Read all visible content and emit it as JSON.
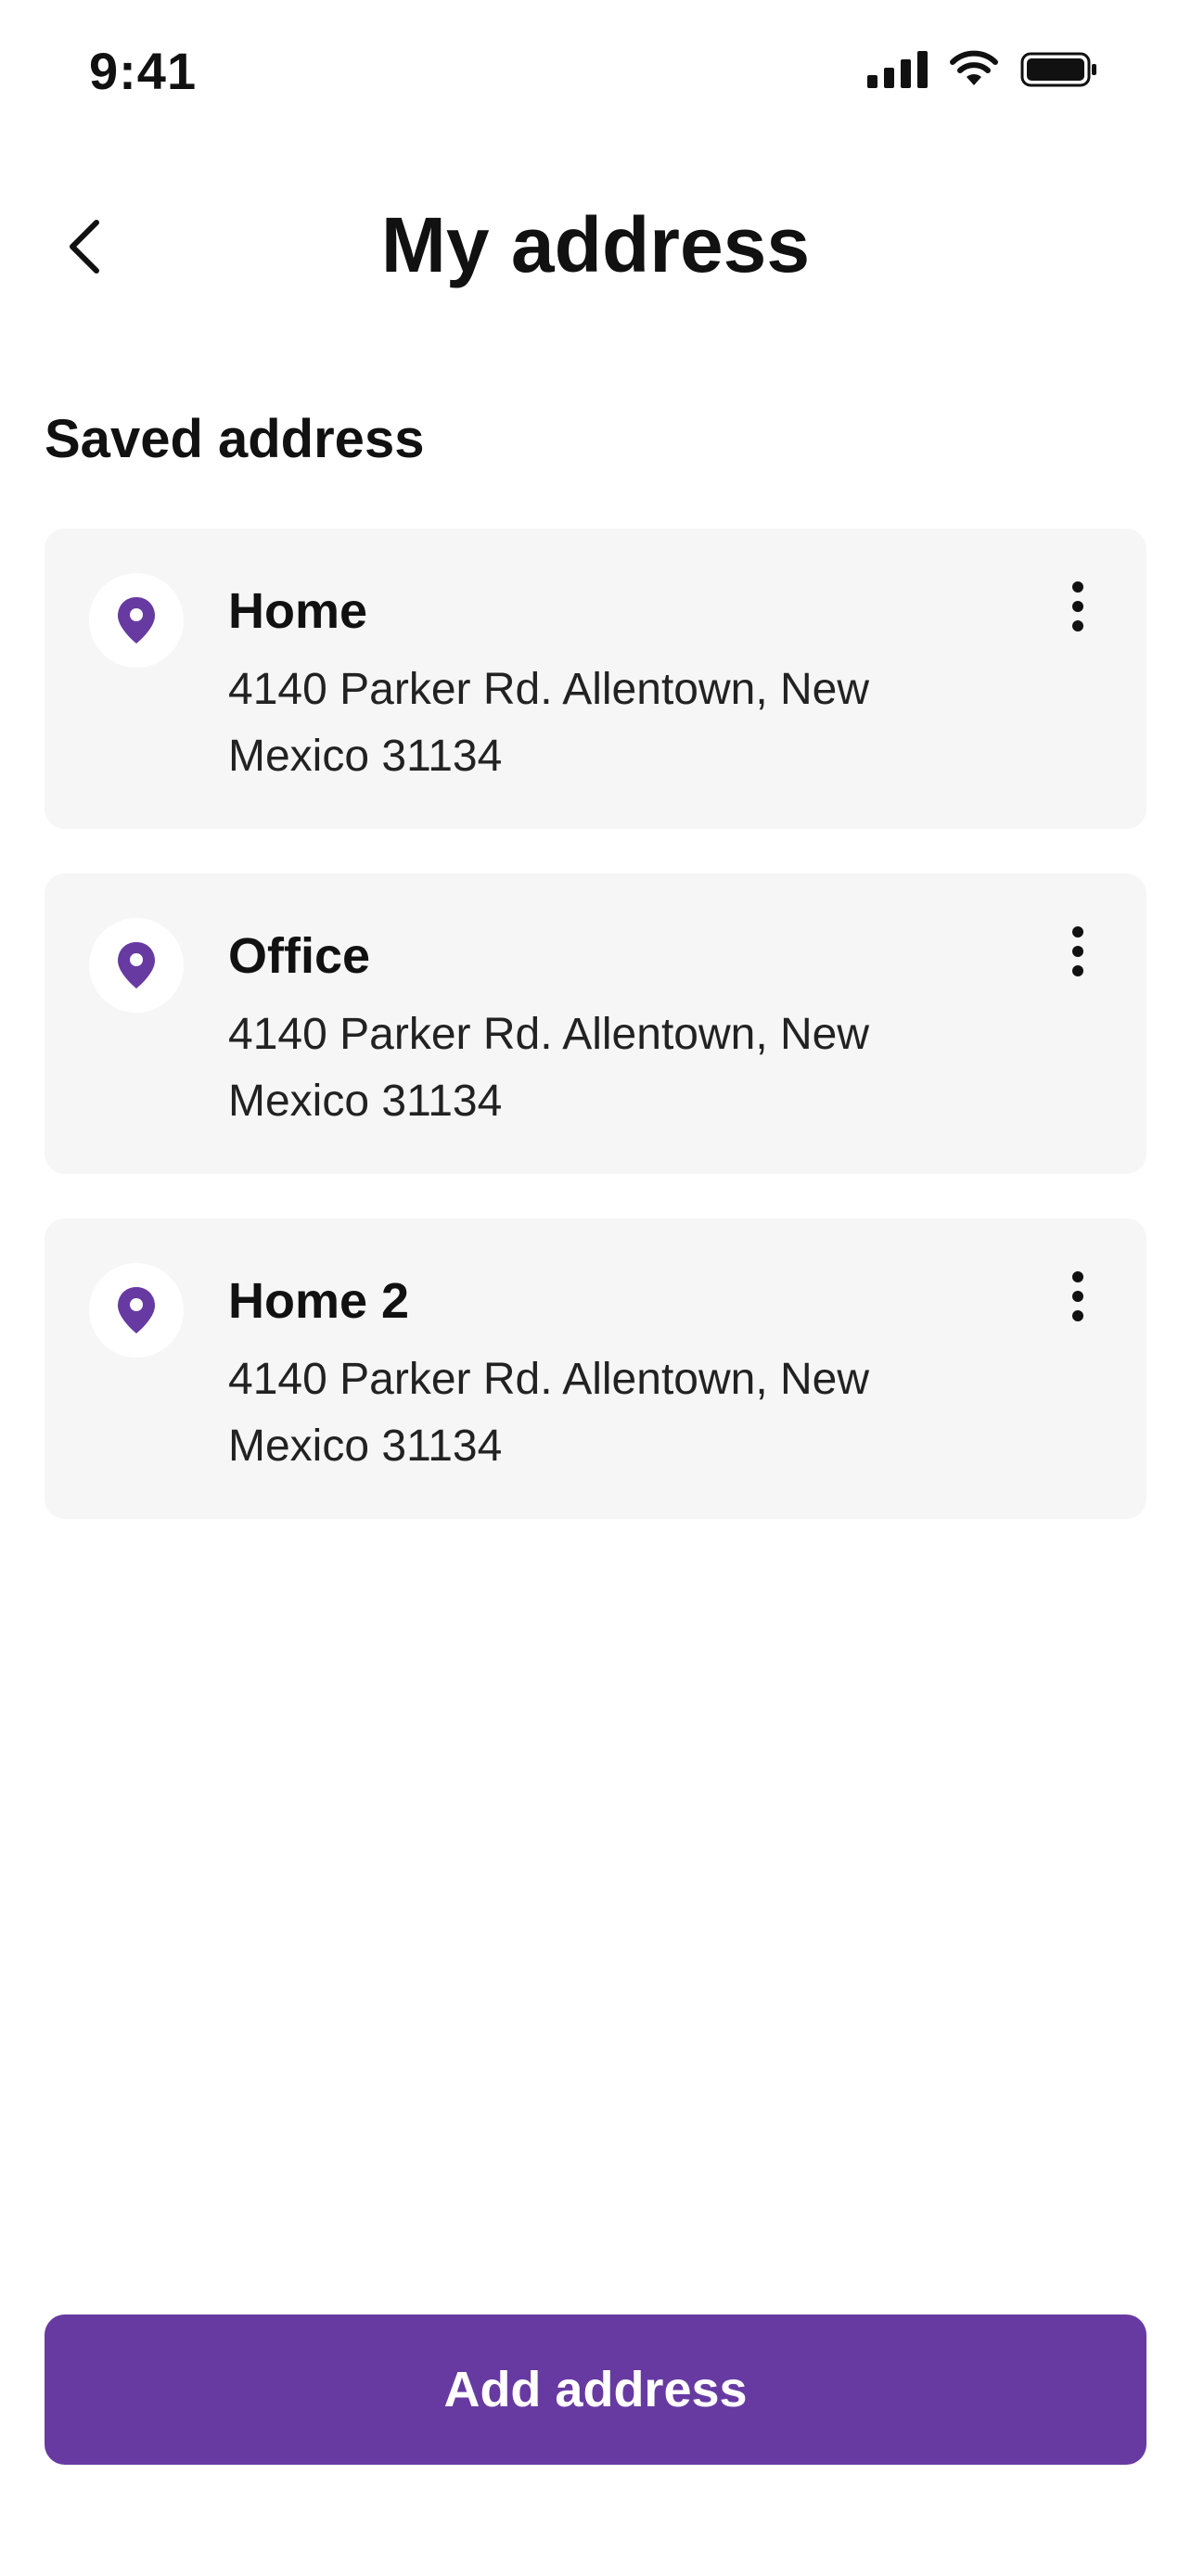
{
  "status_bar": {
    "time": "9:41",
    "signal_icon": "signal-icon",
    "wifi_icon": "wifi-icon",
    "battery_icon": "battery-icon"
  },
  "header": {
    "back_icon": "chevron-left-icon",
    "title": "My address"
  },
  "section": {
    "title": "Saved address"
  },
  "addresses": [
    {
      "name": "Home",
      "line1": "4140 Parker Rd. Allentown, New",
      "line2": "Mexico 31134",
      "icon": "location-pin-icon",
      "menu_icon": "more-vertical-icon"
    },
    {
      "name": "Office",
      "line1": "4140 Parker Rd. Allentown, New",
      "line2": "Mexico 31134",
      "icon": "location-pin-icon",
      "menu_icon": "more-vertical-icon"
    },
    {
      "name": "Home 2",
      "line1": "4140 Parker Rd. Allentown, New",
      "line2": "Mexico 31134",
      "icon": "location-pin-icon",
      "menu_icon": "more-vertical-icon"
    }
  ],
  "actions": {
    "add_label": "Add address"
  },
  "colors": {
    "accent": "#673AA2",
    "card_bg": "#F6F6F6",
    "text": "#111111"
  }
}
